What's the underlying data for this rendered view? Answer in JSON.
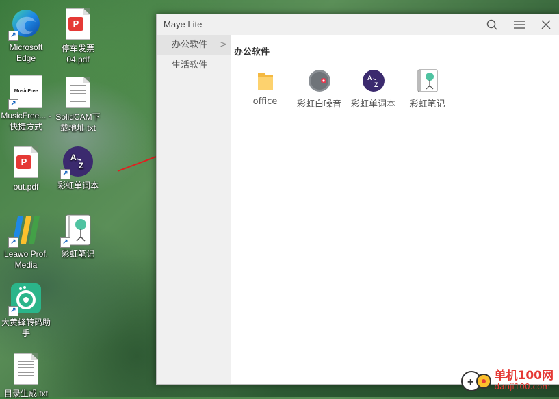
{
  "desktop": {
    "icons": [
      {
        "label": "Microsoft Edge"
      },
      {
        "label": "停车发票04.pdf"
      },
      {
        "label": "MusicFree... - 快捷方式",
        "brand": "MusicFree"
      },
      {
        "label": "SolidCAM下载地址.txt"
      },
      {
        "label": "out.pdf"
      },
      {
        "label": "彩虹单词本"
      },
      {
        "label": "Leawo Prof. Media"
      },
      {
        "label": "彩虹笔记"
      },
      {
        "label": "大黄蜂转码助手"
      },
      {
        "label": "目录生成.txt"
      }
    ]
  },
  "window": {
    "title": "Maye Lite",
    "sidebar": {
      "items": [
        {
          "label": "办公软件",
          "active": true
        },
        {
          "label": "生活软件",
          "active": false
        }
      ]
    },
    "content": {
      "section_title": "办公软件",
      "apps": [
        {
          "label": "office",
          "icon": "folder-icon"
        },
        {
          "label": "彩虹白噪音",
          "icon": "white-noise-icon"
        },
        {
          "label": "彩虹单词本",
          "icon": "word-book-icon"
        },
        {
          "label": "彩虹笔记",
          "icon": "notes-icon"
        }
      ]
    }
  },
  "watermark": {
    "cn": "单机100网",
    "en": "danji100.com"
  },
  "colors": {
    "accent_red": "#e53935",
    "arrow": "#e02020",
    "sidebar_bg": "#f0f0f0"
  }
}
